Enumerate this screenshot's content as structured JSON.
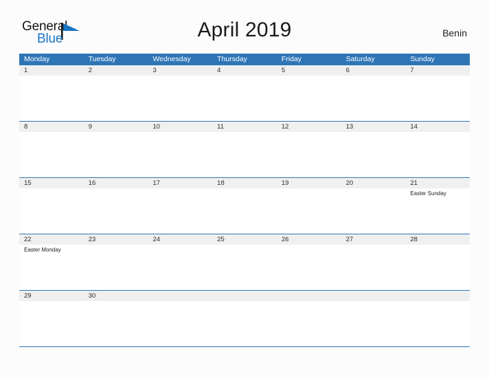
{
  "brand": {
    "word_one": "General",
    "word_two": "Blue",
    "flag_icon": "flag-triangle-icon",
    "accent_color": "#1976c4"
  },
  "header": {
    "title": "April 2019",
    "country": "Benin"
  },
  "colors": {
    "header_blue": "#2e75b6",
    "date_band_gray": "#f0f0f0",
    "page_background": "#fcfcfc",
    "grid_line": "#2e75b6"
  },
  "calendar": {
    "month": "April",
    "year": "2019",
    "weekday_headers": [
      "Monday",
      "Tuesday",
      "Wednesday",
      "Thursday",
      "Friday",
      "Saturday",
      "Sunday"
    ],
    "weeks": [
      {
        "days": [
          {
            "date": "1",
            "events": []
          },
          {
            "date": "2",
            "events": []
          },
          {
            "date": "3",
            "events": []
          },
          {
            "date": "4",
            "events": []
          },
          {
            "date": "5",
            "events": []
          },
          {
            "date": "6",
            "events": []
          },
          {
            "date": "7",
            "events": []
          }
        ]
      },
      {
        "days": [
          {
            "date": "8",
            "events": []
          },
          {
            "date": "9",
            "events": []
          },
          {
            "date": "10",
            "events": []
          },
          {
            "date": "11",
            "events": []
          },
          {
            "date": "12",
            "events": []
          },
          {
            "date": "13",
            "events": []
          },
          {
            "date": "14",
            "events": []
          }
        ]
      },
      {
        "days": [
          {
            "date": "15",
            "events": []
          },
          {
            "date": "16",
            "events": []
          },
          {
            "date": "17",
            "events": []
          },
          {
            "date": "18",
            "events": []
          },
          {
            "date": "19",
            "events": []
          },
          {
            "date": "20",
            "events": []
          },
          {
            "date": "21",
            "events": [
              "Easter Sunday"
            ]
          }
        ]
      },
      {
        "days": [
          {
            "date": "22",
            "events": [
              "Easter Monday"
            ]
          },
          {
            "date": "23",
            "events": []
          },
          {
            "date": "24",
            "events": []
          },
          {
            "date": "25",
            "events": []
          },
          {
            "date": "26",
            "events": []
          },
          {
            "date": "27",
            "events": []
          },
          {
            "date": "28",
            "events": []
          }
        ]
      },
      {
        "days": [
          {
            "date": "29",
            "events": []
          },
          {
            "date": "30",
            "events": []
          },
          {
            "date": "",
            "events": []
          },
          {
            "date": "",
            "events": []
          },
          {
            "date": "",
            "events": []
          },
          {
            "date": "",
            "events": []
          },
          {
            "date": "",
            "events": []
          }
        ]
      }
    ]
  }
}
